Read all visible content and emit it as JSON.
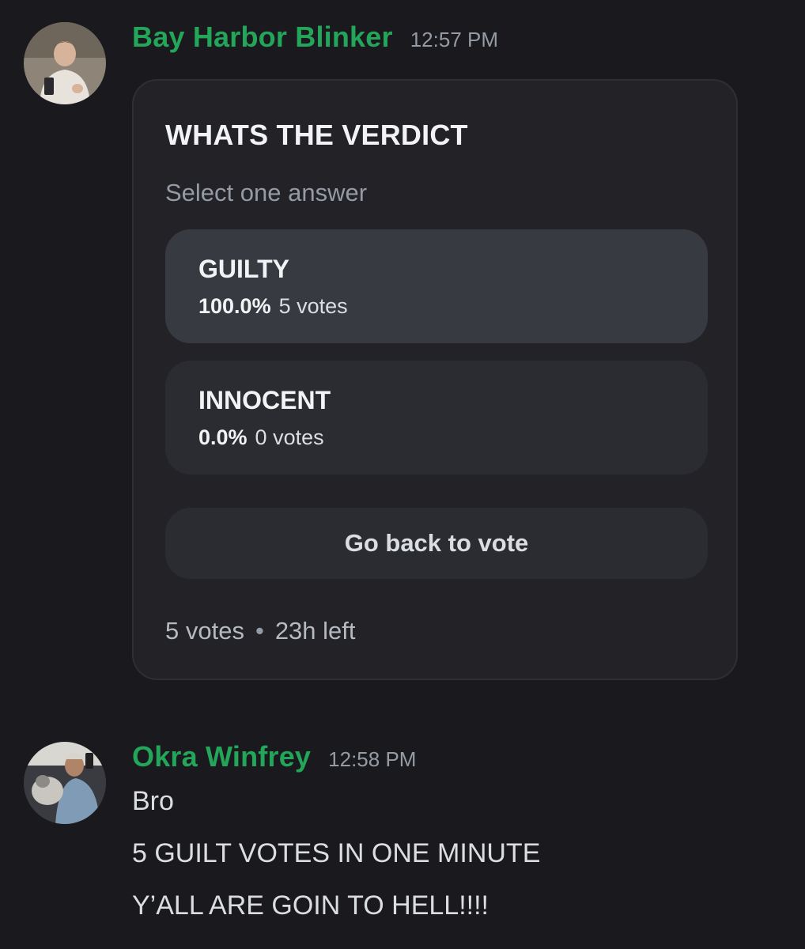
{
  "messages": [
    {
      "username": "Bay Harbor Blinker",
      "timestamp": "12:57 PM",
      "poll": {
        "question": "WHATS THE VERDICT",
        "prompt": "Select one answer",
        "options": [
          {
            "label": "GUILTY",
            "percent": "100.0%",
            "votes": "5 votes",
            "share": 1.0
          },
          {
            "label": "INNOCENT",
            "percent": "0.0%",
            "votes": "0 votes",
            "share": 0.0
          }
        ],
        "action_label": "Go back to vote",
        "total_votes": "5 votes",
        "separator": "•",
        "time_left": "23h left"
      }
    },
    {
      "username": "Okra Winfrey",
      "timestamp": "12:58 PM",
      "lines": [
        "Bro",
        "5 GUILT VOTES IN ONE MINUTE",
        "Y’ALL ARE GOIN TO HELL!!!!"
      ]
    }
  ],
  "colors": {
    "background": "#1a1a1e",
    "username": "#23a55a",
    "timestamp": "#949ba4",
    "poll_card": "#222227",
    "option_selected": "#383a42",
    "option": "#2b2c32"
  }
}
